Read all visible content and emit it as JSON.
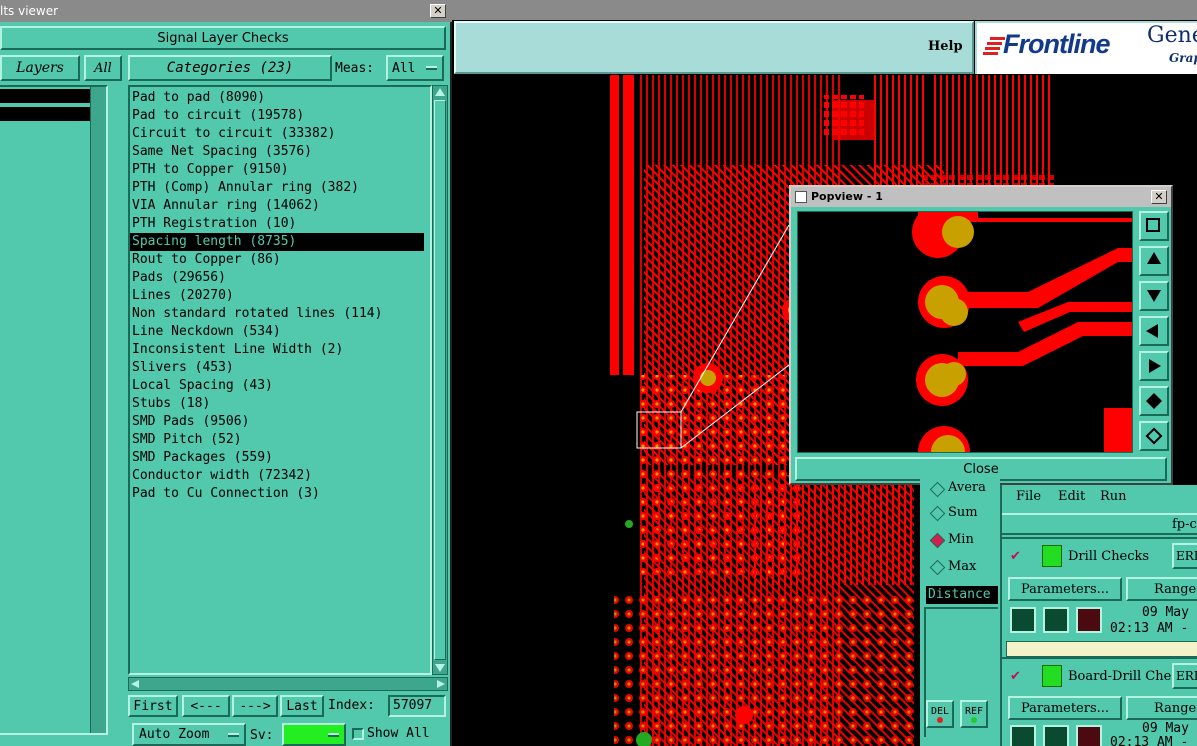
{
  "viewer": {
    "title_fragment": "lts viewer",
    "close_glyph": "✕",
    "checks_title": "Signal Layer Checks",
    "layers_label": "Layers",
    "all_label": "All",
    "categories_label": "Categories (23)",
    "meas_label": "Meas:",
    "meas_value": "All",
    "categories": [
      "Pad to pad (8090)",
      "Pad to circuit (19578)",
      "Circuit to circuit (33382)",
      "Same Net Spacing (3576)",
      "PTH to Copper (9150)",
      "PTH (Comp) Annular ring (382)",
      "VIA Annular ring (14062)",
      "PTH Registration (10)",
      "Spacing length (8735)",
      "Rout to Copper (86)",
      "Pads (29656)",
      "Lines (20270)",
      "Non standard rotated lines (114)",
      "Line Neckdown (534)",
      "Inconsistent Line Width (2)",
      "Slivers (453)",
      "Local Spacing (43)",
      "Stubs (18)",
      "SMD Pads (9506)",
      "SMD Pitch (52)",
      "SMD Packages (559)",
      "Conductor width (72342)",
      "Pad to Cu Connection (3)"
    ],
    "selected_index": 8,
    "nav": {
      "first": "First",
      "prev": "<---",
      "next": "--->",
      "last": "Last",
      "index_label": "Index:",
      "index_value": "57097"
    },
    "auto_zoom": "Auto Zoom",
    "sv_label": "Sv:",
    "show_all": "Show All"
  },
  "toolbar": {
    "help": "Help",
    "brand": "Frontline",
    "brand_suffix": "Gene",
    "brand_sub": "Grap"
  },
  "popview": {
    "title": "Popview - 1",
    "close_glyph": "✕",
    "close_button": "Close"
  },
  "stats": {
    "options": [
      "Avera",
      "Sum",
      "Min",
      "Max"
    ],
    "selected": "Min",
    "distance_label": "Distance"
  },
  "erf": {
    "menu": [
      "File",
      "Edit",
      "Run"
    ],
    "header_fragment": "fp-c",
    "rows": [
      {
        "name": "Drill Checks",
        "erf": "ERF",
        "parameters": "Parameters...",
        "ranges": "Ranges",
        "date": "09 May",
        "time": "02:13 AM -"
      },
      {
        "name": "Board-Drill Che",
        "erf": "ERF",
        "parameters": "Parameters...",
        "ranges": "Ranges",
        "date": "09 May",
        "time": "02:13 AM -"
      }
    ],
    "del_label": "DEL",
    "ref_label": "REF"
  },
  "colors": {
    "panel_teal": "#52c8ad",
    "copper_red": "#ff0000",
    "pad_gold": "#c8a000",
    "toolbar_cyan": "#a8dcd8",
    "sv_green": "#22ee22"
  }
}
